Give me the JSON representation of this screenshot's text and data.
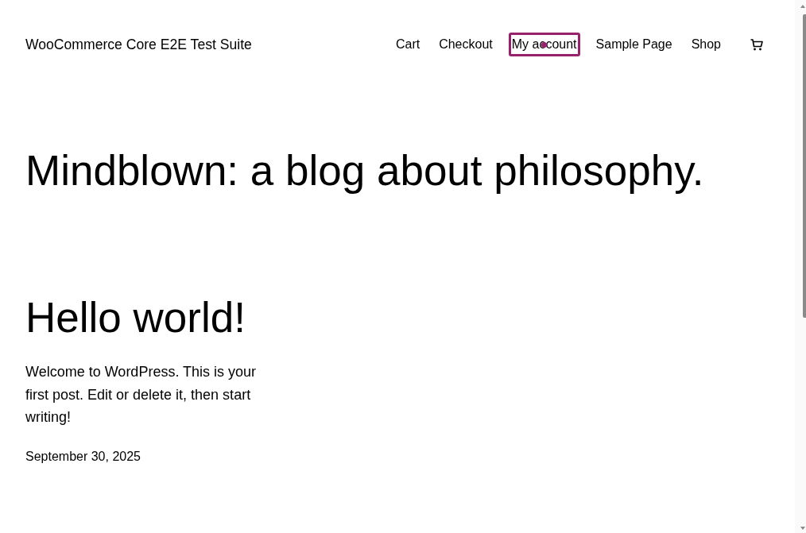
{
  "site_title": "WooCommerce Core E2E Test Suite",
  "nav": [
    {
      "label": "Cart",
      "selected": false
    },
    {
      "label": "Checkout",
      "selected": false
    },
    {
      "label": "My account",
      "selected": true
    },
    {
      "label": "Sample Page",
      "selected": false
    },
    {
      "label": "Shop",
      "selected": false
    }
  ],
  "heading": "Mindblown: a blog about philosophy.",
  "posts": [
    {
      "title": "Hello world!",
      "excerpt": "Welcome to WordPress. This is your first post. Edit or delete it, then start writing!",
      "date": "September 30, 2025"
    }
  ]
}
